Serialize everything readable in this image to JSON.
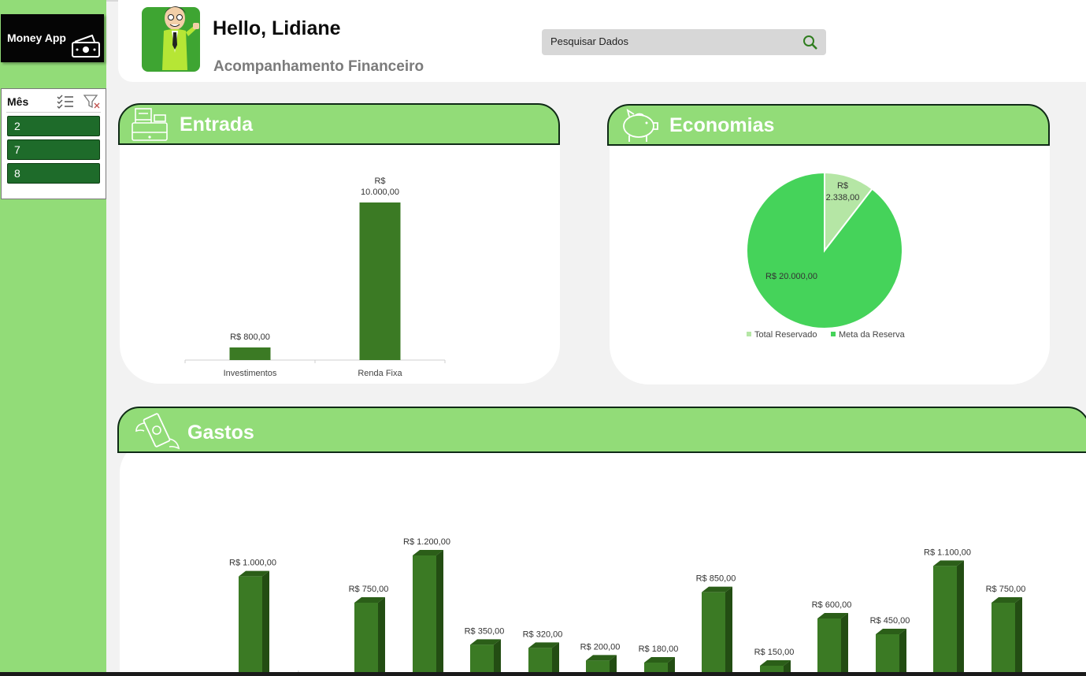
{
  "sidebar": {
    "app_name": "Money App",
    "slicer": {
      "title": "Mês",
      "items": [
        "2",
        "7",
        "8"
      ]
    }
  },
  "header": {
    "greeting": "Hello, Lidiane",
    "subtitle": "Acompanhamento Financeiro",
    "search_placeholder": "Pesquisar Dados"
  },
  "colors": {
    "sidebar": "#92dc78",
    "bar": "#3b7a24",
    "pie_reserved": "#b5e6a5",
    "pie_goal": "#45d35a",
    "slicer_item": "#1e6b2a"
  },
  "cards": {
    "entrada": {
      "title": "Entrada",
      "icon": "cash-register-icon"
    },
    "economias": {
      "title": "Economias",
      "icon": "piggy-bank-icon"
    },
    "gastos": {
      "title": "Gastos",
      "icon": "flying-money-icon"
    }
  },
  "chart_data": [
    {
      "type": "bar",
      "categories": [
        "Investimentos",
        "Renda Fixa"
      ],
      "values": [
        800,
        10000
      ],
      "data_labels": [
        "R$ 800,00",
        "R$ 10.000,00"
      ],
      "title": "",
      "ylim": [
        0,
        10000
      ]
    },
    {
      "type": "pie",
      "categories": [
        "Total Reservado",
        "Meta da Reserva"
      ],
      "values": [
        2338,
        20000
      ],
      "data_labels": [
        "R$ 2.338,00",
        "R$ 20.000,00"
      ],
      "legend": "bottom"
    },
    {
      "type": "bar",
      "values": [
        1000,
        0,
        750,
        1200,
        350,
        320,
        200,
        180,
        850,
        150,
        600,
        450,
        1100,
        750
      ],
      "data_labels": [
        "R$ 1.000,00",
        "",
        "R$ 750,00",
        "R$ 1.200,00",
        "R$ 350,00",
        "R$ 320,00",
        "R$ 200,00",
        "R$ 180,00",
        "R$ 850,00",
        "R$ 150,00",
        "R$ 600,00",
        "R$ 450,00",
        "R$ 1.100,00",
        "R$ 750,00"
      ],
      "ylim": [
        0,
        1200
      ]
    }
  ]
}
